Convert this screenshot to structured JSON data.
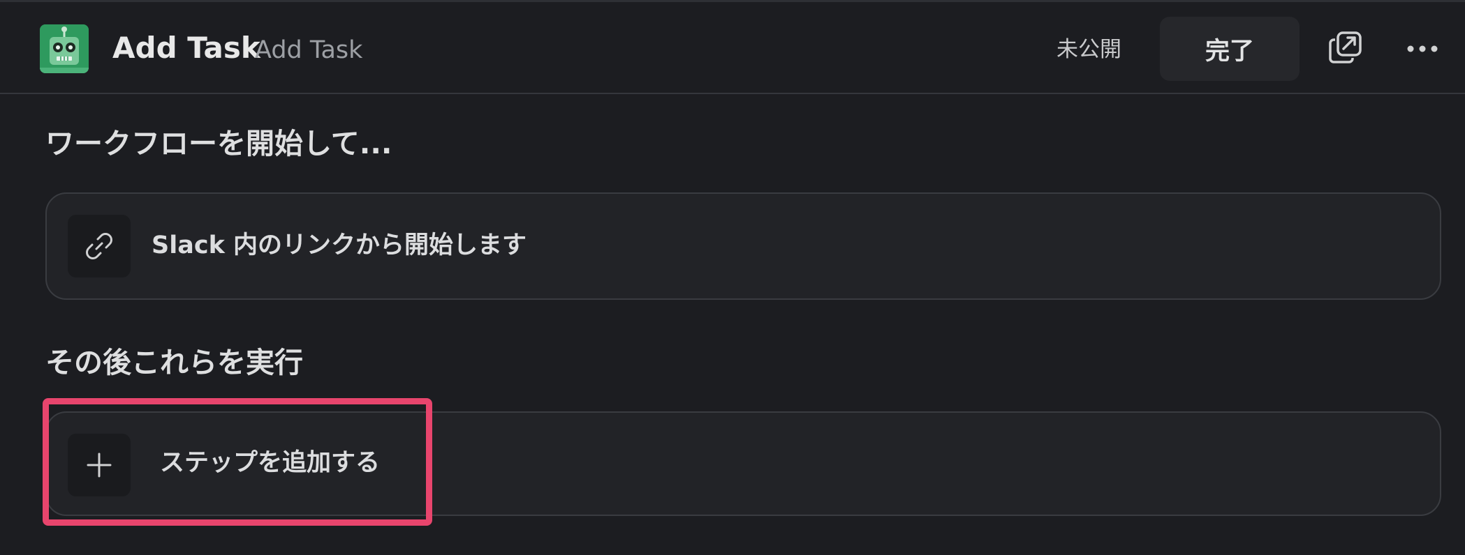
{
  "header": {
    "title": "Add Task",
    "subtitle": "Add Task",
    "status": "未公開",
    "done_label": "完了",
    "icons": {
      "avatar": "robot-avatar",
      "open_window": "open-in-window-icon",
      "more": "more-horizontal-icon"
    }
  },
  "trigger_section": {
    "title": "ワークフローを開始して...",
    "card_label": "Slack 内のリンクから開始します",
    "card_icon": "link-icon"
  },
  "steps_section": {
    "title": "その後これらを実行",
    "add_step_label": "ステップを追加する",
    "add_step_icon": "plus-icon"
  },
  "colors": {
    "background": "#1c1d21",
    "card": "#222327",
    "avatar": "#2e9a5e",
    "highlight": "#e8456d"
  }
}
